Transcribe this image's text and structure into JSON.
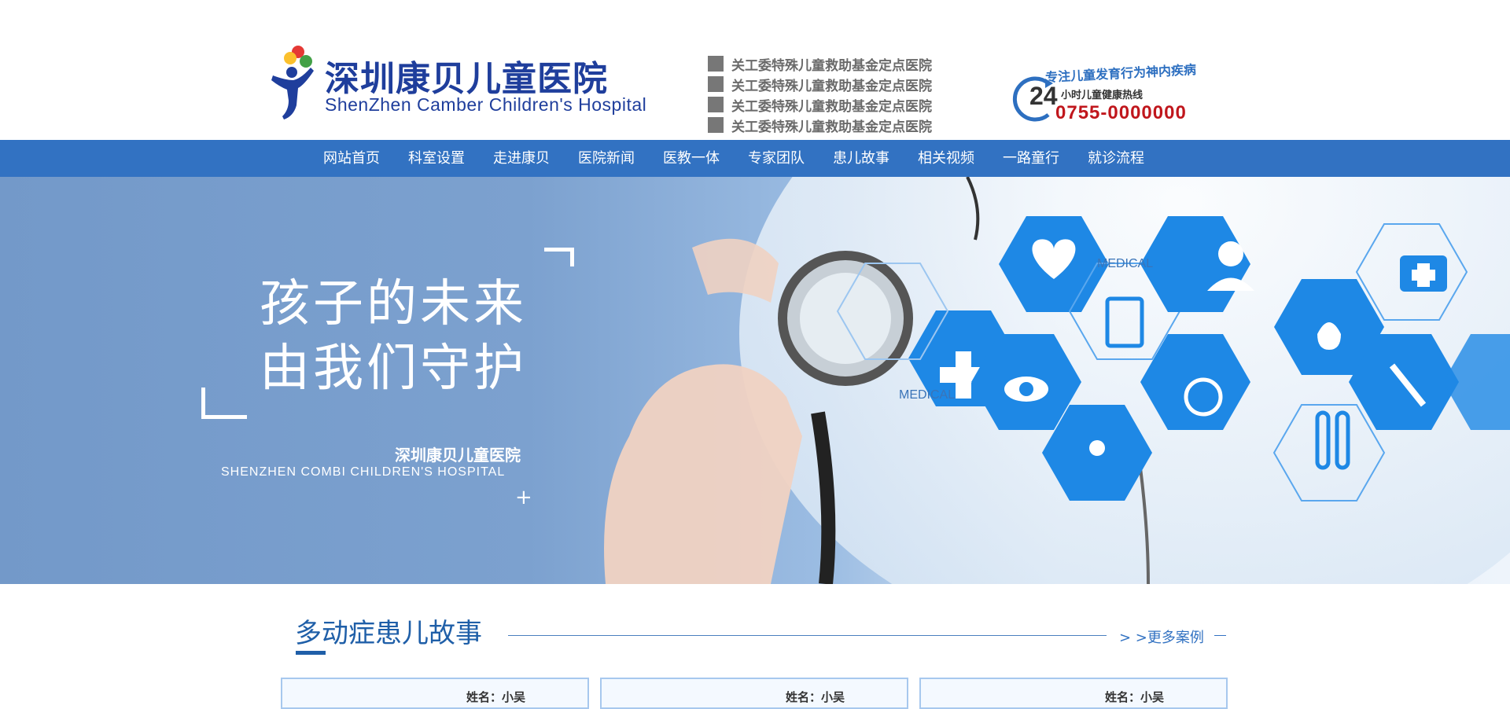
{
  "header": {
    "logo_cn": "深圳康贝儿童医院",
    "logo_en": "ShenZhen Camber Children's Hospital",
    "credentials": [
      "关工委特殊儿童救助基金定点医院",
      "关工委特殊儿童救助基金定点医院",
      "关工委特殊儿童救助基金定点医院",
      "关工委特殊儿童救助基金定点医院"
    ],
    "hotline": {
      "tagline": "专注儿童发育行为神内疾病",
      "hours": "24",
      "label": "小时儿童健康热线",
      "number": "0755-0000000"
    }
  },
  "nav": {
    "items": [
      "网站首页",
      "科室设置",
      "走进康贝",
      "医院新闻",
      "医教一体",
      "专家团队",
      "患儿故事",
      "相关视频",
      "一路童行",
      "就诊流程"
    ]
  },
  "banner": {
    "slogan_line1": "孩子的未来",
    "slogan_line2": "由我们守护",
    "hospital_cn": "深圳康贝儿童医院",
    "hospital_en": "SHENZHEN COMBI CHILDREN'S HOSPITAL",
    "plus": "+",
    "medical_label_1": "MEDICAL",
    "medical_label_2": "MEDICAL"
  },
  "section": {
    "title": "多动症患儿故事",
    "more_link": "> >更多案例"
  },
  "cards": [
    {
      "name": "姓名：小吴"
    },
    {
      "name": "姓名：小吴"
    },
    {
      "name": "姓名：小吴"
    }
  ],
  "colors": {
    "brand_blue": "#1f3e9c",
    "nav_blue": "#3272c2",
    "hotline_red": "#c0161c",
    "hex_blue": "#1e88e5"
  }
}
